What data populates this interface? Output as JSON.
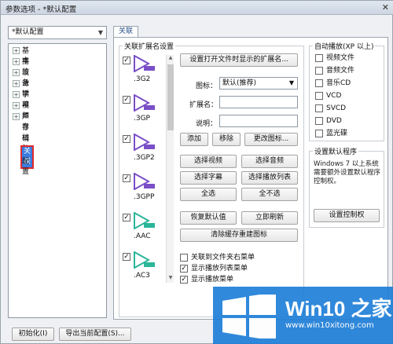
{
  "window": {
    "title": "参数选项 - *默认配置",
    "close_glyph": "✕"
  },
  "preset": {
    "value": "*默认配置"
  },
  "tree": {
    "items": [
      {
        "label": "基本",
        "expandable": true
      },
      {
        "label": "播放",
        "expandable": true
      },
      {
        "label": "设备",
        "expandable": true
      },
      {
        "label": "滤镜",
        "expandable": true
      },
      {
        "label": "字幕",
        "expandable": true
      },
      {
        "label": "视频",
        "expandable": true
      },
      {
        "label": "声音",
        "expandable": true
      },
      {
        "label": "存档",
        "expandable": false
      },
      {
        "label": "辅助",
        "expandable": false
      },
      {
        "label": "关联",
        "expandable": false,
        "selected": true
      },
      {
        "label": "配置",
        "expandable": false
      }
    ]
  },
  "tab": {
    "label": "关联"
  },
  "assoc": {
    "legend": "关联扩展名设置",
    "files": [
      {
        "ext": ".3G2",
        "checked": true,
        "badge": "3G2",
        "color": "#7a4fc7"
      },
      {
        "ext": ".3GP",
        "checked": true,
        "badge": "3GP",
        "color": "#7a4fc7"
      },
      {
        "ext": ".3GP2",
        "checked": true,
        "badge": "3GP2",
        "color": "#7a4fc7"
      },
      {
        "ext": ".3GPP",
        "checked": true,
        "badge": "3GPP",
        "color": "#7a4fc7"
      },
      {
        "ext": ".AAC",
        "checked": true,
        "badge": "AAC",
        "color": "#2bb59a"
      },
      {
        "ext": ".AC3",
        "checked": true,
        "badge": "AC3",
        "color": "#2bb59a"
      }
    ],
    "set_ext_button": "设置打开文件时显示的扩展名...",
    "icon_label": "图标：",
    "icon_value": "默认(推荐)",
    "ext_label": "扩展名：",
    "desc_label": "说明：",
    "btn_add": "添加",
    "btn_remove": "移除",
    "btn_change_icon": "更改图标...",
    "btn_select_video": "选择视频",
    "btn_select_audio": "选择音频",
    "btn_select_subtitle": "选择字幕",
    "btn_select_playlist": "选择播放列表",
    "btn_select_all": "全选",
    "btn_select_none": "全不选",
    "btn_restore_default": "恢复默认值",
    "btn_refresh": "立即刷新",
    "btn_rebuild_icons": "清除缓存重建图标",
    "cb_folder_menu": {
      "label": "关联到文件夹右菜单",
      "checked": false
    },
    "cb_playlist_menu": {
      "label": "显示播放列表菜单",
      "checked": true
    },
    "cb_play_menu": {
      "label": "显示播放菜单",
      "checked": true
    }
  },
  "autoplay": {
    "legend": "自动播放(XP 以上)",
    "items": [
      {
        "label": "视频文件",
        "checked": false
      },
      {
        "label": "音频文件",
        "checked": false
      },
      {
        "label": "音乐CD",
        "checked": false
      },
      {
        "label": "VCD",
        "checked": false
      },
      {
        "label": "SVCD",
        "checked": false
      },
      {
        "label": "DVD",
        "checked": false
      },
      {
        "label": "蓝光碟",
        "checked": false
      }
    ]
  },
  "default_program": {
    "legend": "设置默认程序",
    "description": "Windows 7 以上系统需要额外设置默认程序控制权。",
    "button": "设置控制权"
  },
  "footer": {
    "init_button": "初始化(I)",
    "export_button": "导出当前配置(S)..."
  },
  "watermark": {
    "name": "Win10 之家",
    "url": "www.win10xitong.com"
  },
  "colors": {
    "accent": "#3b7de0",
    "highlight_border": "#e32b2b",
    "brand": "#1f7fd8"
  }
}
